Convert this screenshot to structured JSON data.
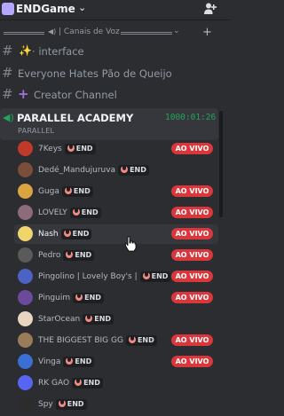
{
  "server": {
    "name": "ENDGame",
    "logo_color": "#b7a6ff"
  },
  "category": {
    "label": "| Canais de Voz"
  },
  "channels": [
    {
      "label": "interface",
      "prefix": "✨ ·"
    },
    {
      "label": "Everyone Hates Pão de Queijo"
    },
    {
      "label": "Creator Channel"
    }
  ],
  "active_channel": {
    "name": "PARALLEL ACADEMY",
    "timer": "1000:01:26",
    "subtitle": "PARALLEL"
  },
  "tag_label": "END",
  "live_label": "AO VIVO",
  "members": [
    {
      "name": "7Keys",
      "live": true,
      "color": "#c0392b"
    },
    {
      "name": "Dedé_Mandujuruva",
      "live": false,
      "color": "#7a4f3a"
    },
    {
      "name": "Guga",
      "live": true,
      "color": "#d9a441"
    },
    {
      "name": "LOVELY",
      "live": true,
      "color": "#8c6b7a"
    },
    {
      "name": "Nash",
      "live": true,
      "color": "#f0d56b",
      "hover": true
    },
    {
      "name": "Pedro",
      "live": true,
      "color": "#5a5a5a"
    },
    {
      "name": "Pingolino | Lovely Boy's |",
      "live": true,
      "color": "#4a63c4"
    },
    {
      "name": "Pinguim",
      "live": true,
      "color": "#6b4a9c"
    },
    {
      "name": "StarOcean",
      "live": false,
      "color": "#e8d6c2"
    },
    {
      "name": "THE BIGGEST BIG GG",
      "live": true,
      "color": "#9a7b5a"
    },
    {
      "name": "Vinga",
      "live": true,
      "color": "#3a6fd4"
    },
    {
      "name": "RK GAO",
      "live": false,
      "color": "#5865f2"
    },
    {
      "name": "Spy",
      "live": false,
      "color": "#2c2c2c"
    }
  ],
  "colors": {
    "live": "#da373c",
    "voice_green": "#23a559",
    "background": "#2b2d31"
  },
  "icons": [
    "add-member-icon",
    "speaker-icon",
    "hash-icon",
    "plus-icon",
    "chevron-down-icon",
    "cursor-hand-icon"
  ]
}
